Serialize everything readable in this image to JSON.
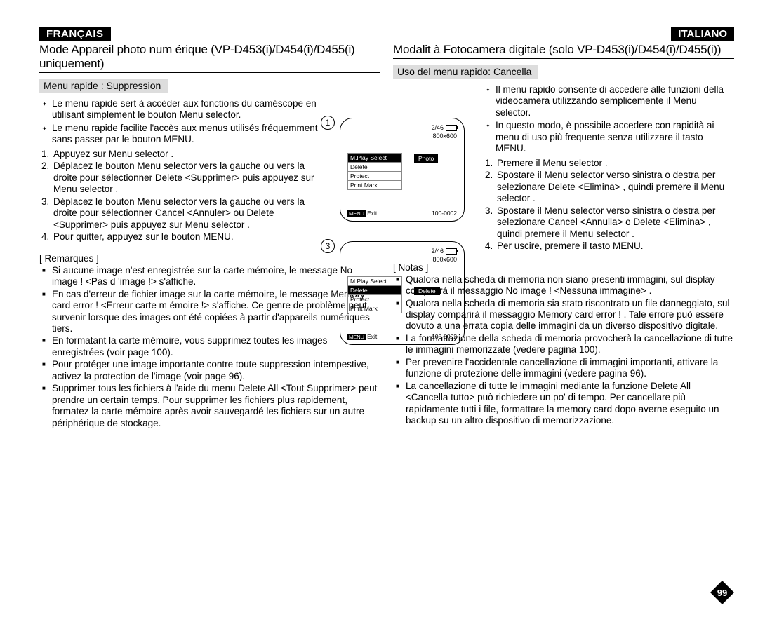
{
  "page_number": "99",
  "fr": {
    "lang": "FRANÇAIS",
    "header": "Mode Appareil photo num   érique (VP-D453(i)/D454(i)/D455(i) uniquement)",
    "subhead": "Menu rapide : Suppression",
    "intro1": "Le menu rapide sert à accéder aux fonctions du caméscope en utilisant simplement le bouton Menu selector.",
    "intro2": "Le menu rapide facilite l'accès aux menus utilisés fréquemment sans passer par le bouton MENU.",
    "s1": "Appuyez sur Menu selector .",
    "s2": "Déplacez le bouton Menu selector  vers la gauche ou vers la droite pour sélectionner Delete <Supprimer>  puis appuyez sur Menu selector .",
    "s3": "Déplacez le bouton Menu selector  vers la gauche ou vers la droite pour sélectionner Cancel <Annuler>  ou Delete <Supprimer>  puis appuyez sur Menu selector .",
    "s4": "Pour quitter, appuyez sur le bouton MENU.",
    "notes_title": "[ Remarques ]",
    "n1": "Si aucune image n'est enregistrée sur la carte mémoire, le message No image ! <Pas d 'image !>  s'affiche.",
    "n2": "En cas d'erreur de fichier image sur la carte mémoire, le message Memory card error !   <Erreur carte m  émoire !>  s'affiche. Ce genre de problème peut survenir lorsque des images ont été copiées à partir d'appareils numériques tiers.",
    "n3": "En formatant la carte mémoire, vous supprimez toutes les images enregistrées (voir page 100).",
    "n4": "Pour protéger une image importante contre toute suppression intempestive, activez la protection de l'image (voir page 96).",
    "n5": "Supprimer tous les fichiers à l'aide du menu Delete All <Tout Supprimer> peut prendre un certain temps. Pour supprimer les fichiers plus rapidement, formatez la carte mémoire après avoir sauvegardé les fichiers sur un autre périphérique de stockage."
  },
  "it": {
    "lang": "ITALIANO",
    "header": "Modalit à Fotocamera digitale (solo VP-D453(i)/D454(i)/D455(i))",
    "subhead": "Uso del menu rapido: Cancella",
    "intro1": "Il menu rapido consente di accedere alle funzioni della videocamera utilizzando semplicemente il Menu selector.",
    "intro2": "In questo modo, è possibile accedere con rapidità ai menu di uso più frequente senza utilizzare il tasto MENU.",
    "s1": "Premere il Menu selector .",
    "s2": "Spostare il Menu selector  verso sinistra o destra per selezionare Delete <Elimina> , quindi premere il Menu selector .",
    "s3": "Spostare il Menu selector  verso sinistra o destra per selezionare Cancel <Annulla>  o Delete <Elimina> , quindi premere il Menu selector .",
    "s4": "Per uscire, premere il tasto MENU.",
    "notes_title": "[ Notas ]",
    "n1": "Qualora nella scheda di memoria non siano presenti immagini, sul display comparirà il messaggio No image ! <Nessuna immagine>  .",
    "n2": "Qualora nella scheda di memoria sia stato riscontrato un file danneggiato, sul display comparirà il messaggio Memory card error !  . Tale errore può essere dovuto a una errata copia delle immagini da un diverso dispositivo digitale.",
    "n3": "La formattazione della scheda di memoria provocherà la cancellazione di tutte le immagini memorizzate (vedere pagina 100).",
    "n4": "Per prevenire l'accidentale cancellazione di immagini importanti, attivare la funzione di protezione delle immagini (vedere pagina 96).",
    "n5": "La cancellazione di tutte le immagini mediante la funzione Delete All <Cancella tutto>  può richiedere un po' di tempo. Per cancellare più rapidamente tutti i file, formattare la memory card dopo averne eseguito un backup su un altro dispositivo di memorizzazione."
  },
  "fig": {
    "n1": "1",
    "n3": "3",
    "counter": "2/46",
    "res": "800x600",
    "mplay": "M.Play Select",
    "delete": "Delete",
    "protect": "Protect",
    "printmark": "Print Mark",
    "photo": "Photo",
    "menu": "MENU",
    "exit": "Exit",
    "fileno": "100-0002"
  }
}
